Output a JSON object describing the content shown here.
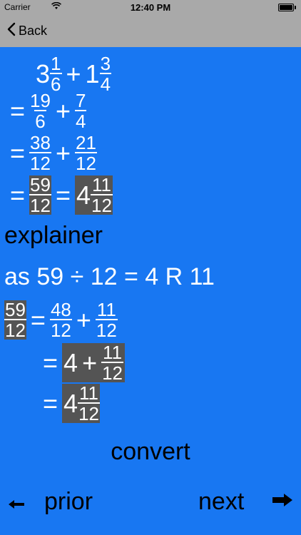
{
  "status": {
    "carrier": "Carrier",
    "time": "12:40 PM"
  },
  "nav": {
    "back_label": "Back"
  },
  "problem": {
    "w1": "3",
    "n1": "1",
    "d1": "6",
    "plus": "+",
    "w2": "1",
    "n2": "3",
    "d2": "4"
  },
  "step1": {
    "eq": "=",
    "n1": "19",
    "d1": "6",
    "plus": "+",
    "n2": "7",
    "d2": "4"
  },
  "step2": {
    "eq": "=",
    "n1": "38",
    "d1": "12",
    "plus": "+",
    "n2": "21",
    "d2": "12"
  },
  "step3": {
    "eq1": "=",
    "n": "59",
    "d": "12",
    "eq2": "=",
    "whole": "4",
    "rn": "11",
    "rd": "12"
  },
  "explainer_label": "explainer",
  "division_text": "as 59 ÷ 12 = 4 R 11",
  "ex1": {
    "n": "59",
    "d": "12",
    "eq": "=",
    "n1": "48",
    "d1": "12",
    "plus": "+",
    "n2": "11",
    "d2": "12"
  },
  "ex2": {
    "eq": "=",
    "whole": "4",
    "plus": "+",
    "n": "11",
    "d": "12"
  },
  "ex3": {
    "eq": "=",
    "whole": "4",
    "n": "11",
    "d": "12"
  },
  "convert_label": "convert",
  "prior_label": "prior",
  "next_label": "next",
  "colors": {
    "background": "#1877f2",
    "bar": "#a9a9a9",
    "highlight": "#545454"
  }
}
